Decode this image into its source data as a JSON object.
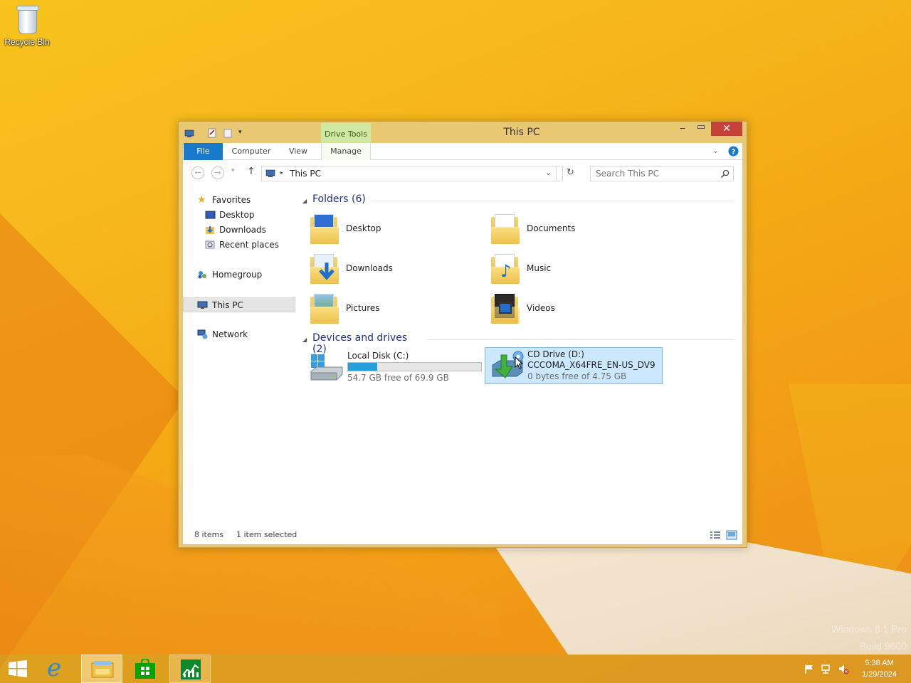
{
  "desktop": {
    "recycle_bin_label": "Recycle Bin",
    "watermark_line1": "Windows 8.1 Pro",
    "watermark_line2": "Build 9600"
  },
  "window": {
    "title": "This PC",
    "context_tab": "Drive Tools",
    "ribbon_tabs": [
      "File",
      "Computer",
      "View",
      "Manage"
    ],
    "address_path": "This PC",
    "search_placeholder": "Search This PC"
  },
  "nav_pane": {
    "favorites": "Favorites",
    "favorites_items": [
      "Desktop",
      "Downloads",
      "Recent places"
    ],
    "homegroup": "Homegroup",
    "this_pc": "This PC",
    "network": "Network"
  },
  "folders": {
    "header": "Folders (6)",
    "items": [
      "Desktop",
      "Documents",
      "Downloads",
      "Music",
      "Pictures",
      "Videos"
    ]
  },
  "devices": {
    "header": "Devices and drives (2)",
    "local_disk": {
      "name": "Local Disk (C:)",
      "free_text": "54.7 GB free of 69.9 GB",
      "used_fraction": 0.217
    },
    "cd_drive": {
      "name": "CD Drive (D:)",
      "label": "CCCOMA_X64FRE_EN-US_DV9",
      "free_text": "0 bytes free of 4.75 GB"
    }
  },
  "status": {
    "items_count": "8 items",
    "selected": "1 item selected"
  },
  "taskbar": {
    "time": "5:38 AM",
    "date": "1/29/2024"
  },
  "colors": {
    "accent_blue": "#1979ca",
    "close_red": "#c7413a",
    "selection": "#cce8ff",
    "progress": "#26a0da",
    "window_frame": "#e8c872"
  }
}
